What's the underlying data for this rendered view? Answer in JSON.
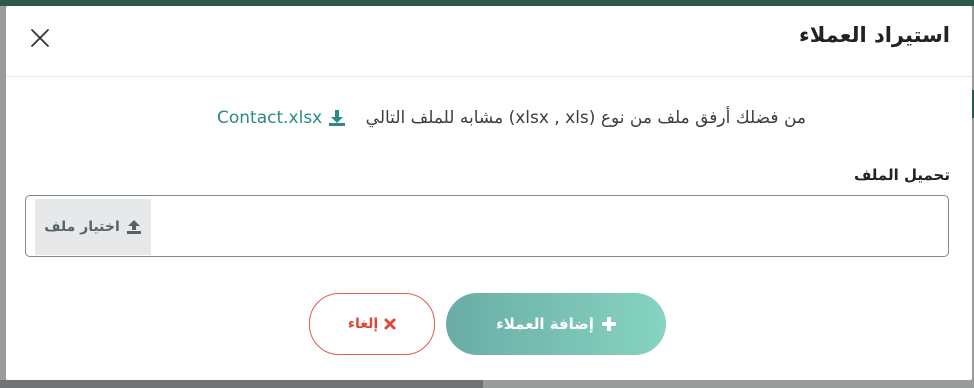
{
  "modal": {
    "title": "استيراد العملاء"
  },
  "hint": {
    "text": "من فضلك أرفق ملف من نوع (xlsx , xls) مشابه للملف التالي",
    "download_link_label": "Contact.xlsx",
    "link_color": "#2a8c84"
  },
  "upload": {
    "label": "تحميل الملف",
    "choose_button_label": "اختيار ملف"
  },
  "actions": {
    "add_label": "إضافة العملاء",
    "cancel_label": "إلغاء",
    "cancel_color": "#e0473c"
  },
  "icons": {
    "close": "close-icon",
    "download": "download-icon",
    "upload": "upload-icon",
    "plus": "plus-icon",
    "cancel_x": "times-icon"
  }
}
